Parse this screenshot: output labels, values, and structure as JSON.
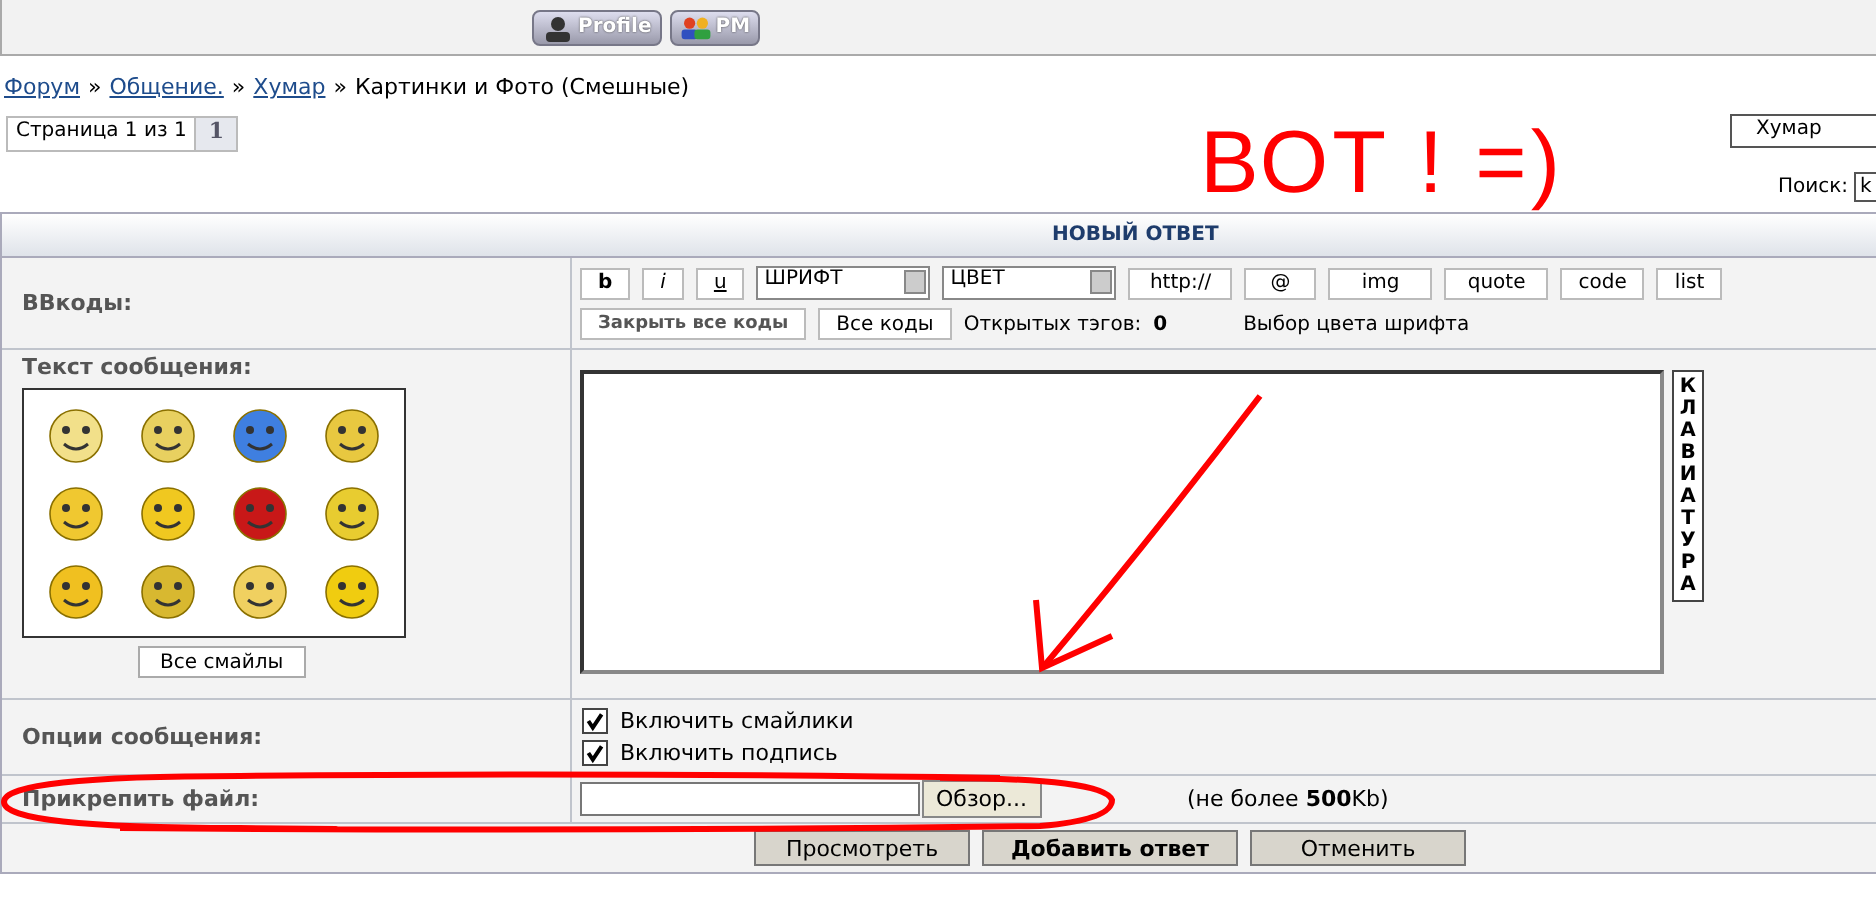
{
  "header": {
    "buttons": [
      {
        "label": "Profile",
        "kind": "profile"
      },
      {
        "label": "PM",
        "kind": "pm"
      }
    ]
  },
  "breadcrumb": {
    "links": [
      "Форум",
      "Общение.",
      "Хумар"
    ],
    "separator": "»",
    "current": "Картинки и Фото (Смешные)"
  },
  "pagination": {
    "label": "Страница 1 из 1",
    "pages": [
      {
        "label": "1",
        "selected": true
      }
    ]
  },
  "forum_jump": {
    "value": "Хумар"
  },
  "search": {
    "label": "Поиск:",
    "value": "k"
  },
  "form": {
    "title": "НОВЫЙ ОТВЕТ",
    "bbcode_label": "BBкоды:",
    "tags": [
      {
        "label": "b",
        "kind": "button"
      },
      {
        "label": "i",
        "kind": "button"
      },
      {
        "label": "u",
        "kind": "button"
      },
      {
        "label": "ШРИФТ",
        "kind": "select"
      },
      {
        "label": "ЦВЕТ",
        "kind": "select"
      },
      {
        "label": "http://",
        "kind": "button"
      },
      {
        "label": "@",
        "kind": "button"
      },
      {
        "label": "img",
        "kind": "button"
      },
      {
        "label": "quote",
        "kind": "button"
      },
      {
        "label": "code",
        "kind": "button"
      },
      {
        "label": "list",
        "kind": "button"
      }
    ],
    "close_all": "Закрыть все коды",
    "all_codes": "Все коды",
    "open_tags_label": "Открытых тэгов:",
    "open_tags": "0",
    "color_hint": "Выбор цвета шрифта",
    "message_label": "Текст сообщения:",
    "smilies": [
      {
        "color": "#f2e08a"
      },
      {
        "color": "#e8d060"
      },
      {
        "color": "#3f7fe0"
      },
      {
        "color": "#e8c840"
      },
      {
        "color": "#f0c830"
      },
      {
        "color": "#f0c820"
      },
      {
        "color": "#c81818"
      },
      {
        "color": "#e8cc30"
      },
      {
        "color": "#f0c020"
      },
      {
        "color": "#d8b830"
      },
      {
        "color": "#f0d060"
      },
      {
        "color": "#f0cc10"
      }
    ],
    "all_smilies": "Все смайлы",
    "keyboard": "КЛАВИАТУРА",
    "options_label": "Опции сообщения:",
    "options": [
      {
        "label": "Включить смайлики",
        "checked": true
      },
      {
        "label": "Включить подпись",
        "checked": true
      }
    ],
    "attach_label": "Прикрепить файл:",
    "browse": "Обзор...",
    "limit": "(не более **500**Kb)",
    "buttons": [
      {
        "label": "Просмотреть",
        "primary": false
      },
      {
        "label": "Добавить ответ",
        "primary": true
      },
      {
        "label": "Отменить",
        "primary": false
      }
    ]
  },
  "annotation": {
    "text": "ВОТ ! =)"
  }
}
